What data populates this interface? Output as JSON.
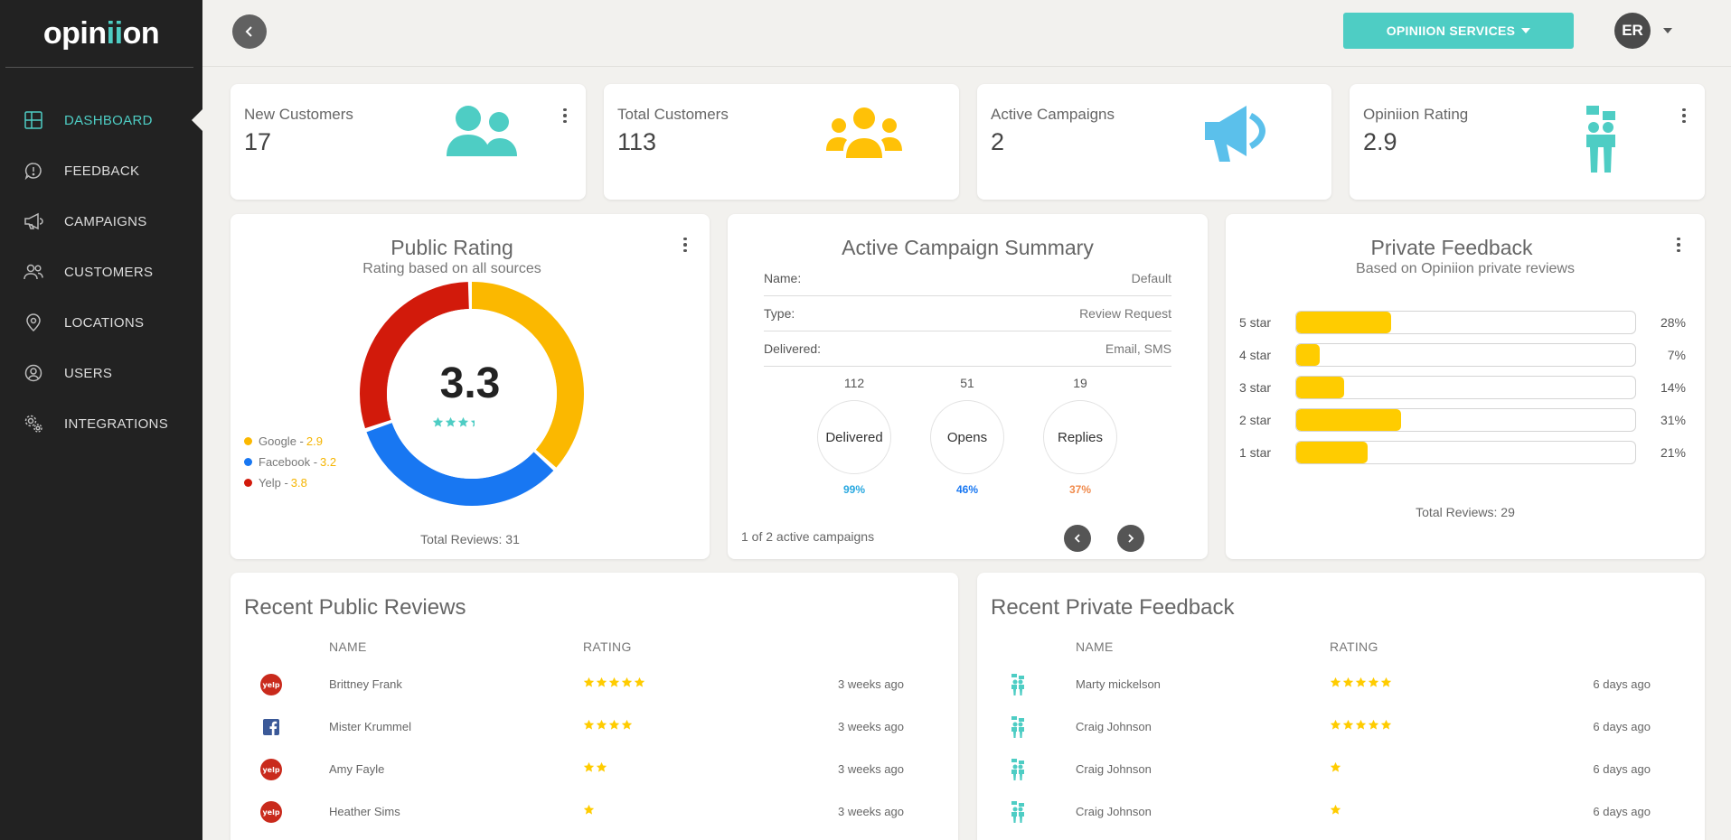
{
  "brand": {
    "logo_pre": "opin",
    "logo_mark": "ii",
    "logo_post": "on"
  },
  "sidebar": {
    "items": [
      {
        "label": "DASHBOARD",
        "icon": "dashboard-icon",
        "active": true
      },
      {
        "label": "FEEDBACK",
        "icon": "feedback-icon"
      },
      {
        "label": "CAMPAIGNS",
        "icon": "megaphone-icon"
      },
      {
        "label": "CUSTOMERS",
        "icon": "users-icon"
      },
      {
        "label": "LOCATIONS",
        "icon": "location-pin-icon"
      },
      {
        "label": "USERS",
        "icon": "user-circle-icon"
      },
      {
        "label": "INTEGRATIONS",
        "icon": "gears-icon"
      }
    ]
  },
  "topbar": {
    "services_label": "OPINIION SERVICES",
    "avatar_initials": "ER"
  },
  "stats": [
    {
      "label": "New Customers",
      "value": "17",
      "icon": "two-users-icon",
      "color": "#4ecdc4"
    },
    {
      "label": "Total Customers",
      "value": "113",
      "icon": "group-icon",
      "color": "#ffc107"
    },
    {
      "label": "Active Campaigns",
      "value": "2",
      "icon": "megaphone-icon",
      "color": "#5bc0eb"
    },
    {
      "label": "Opiniion Rating",
      "value": "2.9",
      "icon": "opiniion-people-icon",
      "color": "#4ecdc4"
    }
  ],
  "public_rating": {
    "title": "Public Rating",
    "subtitle": "Rating based on all sources",
    "score": "3.3",
    "stars": 3.3,
    "total": "Total Reviews: 31",
    "sources": [
      {
        "name": "Google",
        "value": "2.9",
        "color": "#fbb800",
        "share": 0.37
      },
      {
        "name": "Facebook",
        "value": "3.2",
        "color": "#1877f2",
        "share": 0.33
      },
      {
        "name": "Yelp",
        "value": "3.8",
        "color": "#d21a0b",
        "share": 0.3
      }
    ]
  },
  "campaign": {
    "title": "Active Campaign Summary",
    "rows": [
      {
        "key": "Name:",
        "value": "Default"
      },
      {
        "key": "Type:",
        "value": "Review Request"
      },
      {
        "key": "Delivered:",
        "value": "Email, SMS"
      }
    ],
    "metrics": [
      {
        "count": "112",
        "label": "Delivered",
        "pct": "99%",
        "color": "#29a8e0"
      },
      {
        "count": "51",
        "label": "Opens",
        "pct": "46%",
        "color": "#1877f2"
      },
      {
        "count": "19",
        "label": "Replies",
        "pct": "37%",
        "color": "#f08a4b"
      }
    ],
    "pager_text": "1 of 2 active campaigns"
  },
  "private_feedback": {
    "title": "Private Feedback",
    "subtitle": "Based on Opiniion private reviews",
    "bars": [
      {
        "label": "5 star",
        "pct": "28%",
        "fraction": 0.28
      },
      {
        "label": "4 star",
        "pct": "7%",
        "fraction": 0.07
      },
      {
        "label": "3 star",
        "pct": "14%",
        "fraction": 0.14
      },
      {
        "label": "2 star",
        "pct": "31%",
        "fraction": 0.31
      },
      {
        "label": "1 star",
        "pct": "21%",
        "fraction": 0.21
      }
    ],
    "total": "Total Reviews: 29"
  },
  "public_reviews": {
    "title": "Recent Public Reviews",
    "col_name": "NAME",
    "col_rating": "RATING",
    "rows": [
      {
        "source": "yelp-icon",
        "name": "Brittney Frank",
        "rating": 5,
        "time": "3 weeks ago"
      },
      {
        "source": "facebook-icon",
        "name": "Mister Krummel",
        "rating": 4,
        "time": "3 weeks ago"
      },
      {
        "source": "yelp-icon",
        "name": "Amy Fayle",
        "rating": 2,
        "time": "3 weeks ago"
      },
      {
        "source": "yelp-icon",
        "name": "Heather Sims",
        "rating": 1,
        "time": "3 weeks ago"
      }
    ]
  },
  "private_reviews": {
    "title": "Recent Private Feedback",
    "col_name": "NAME",
    "col_rating": "RATING",
    "rows": [
      {
        "source": "opiniion-icon",
        "name": "Marty mickelson",
        "rating": 5,
        "time": "6 days ago"
      },
      {
        "source": "opiniion-icon",
        "name": "Craig Johnson",
        "rating": 5,
        "time": "6 days ago"
      },
      {
        "source": "opiniion-icon",
        "name": "Craig Johnson",
        "rating": 1,
        "time": "6 days ago"
      },
      {
        "source": "opiniion-icon",
        "name": "Craig Johnson",
        "rating": 1,
        "time": "6 days ago"
      }
    ]
  },
  "colors": {
    "accent": "#4ecdc4",
    "sidebar": "#222222",
    "star": "#ffcc00",
    "bar": "#ffcc00"
  }
}
